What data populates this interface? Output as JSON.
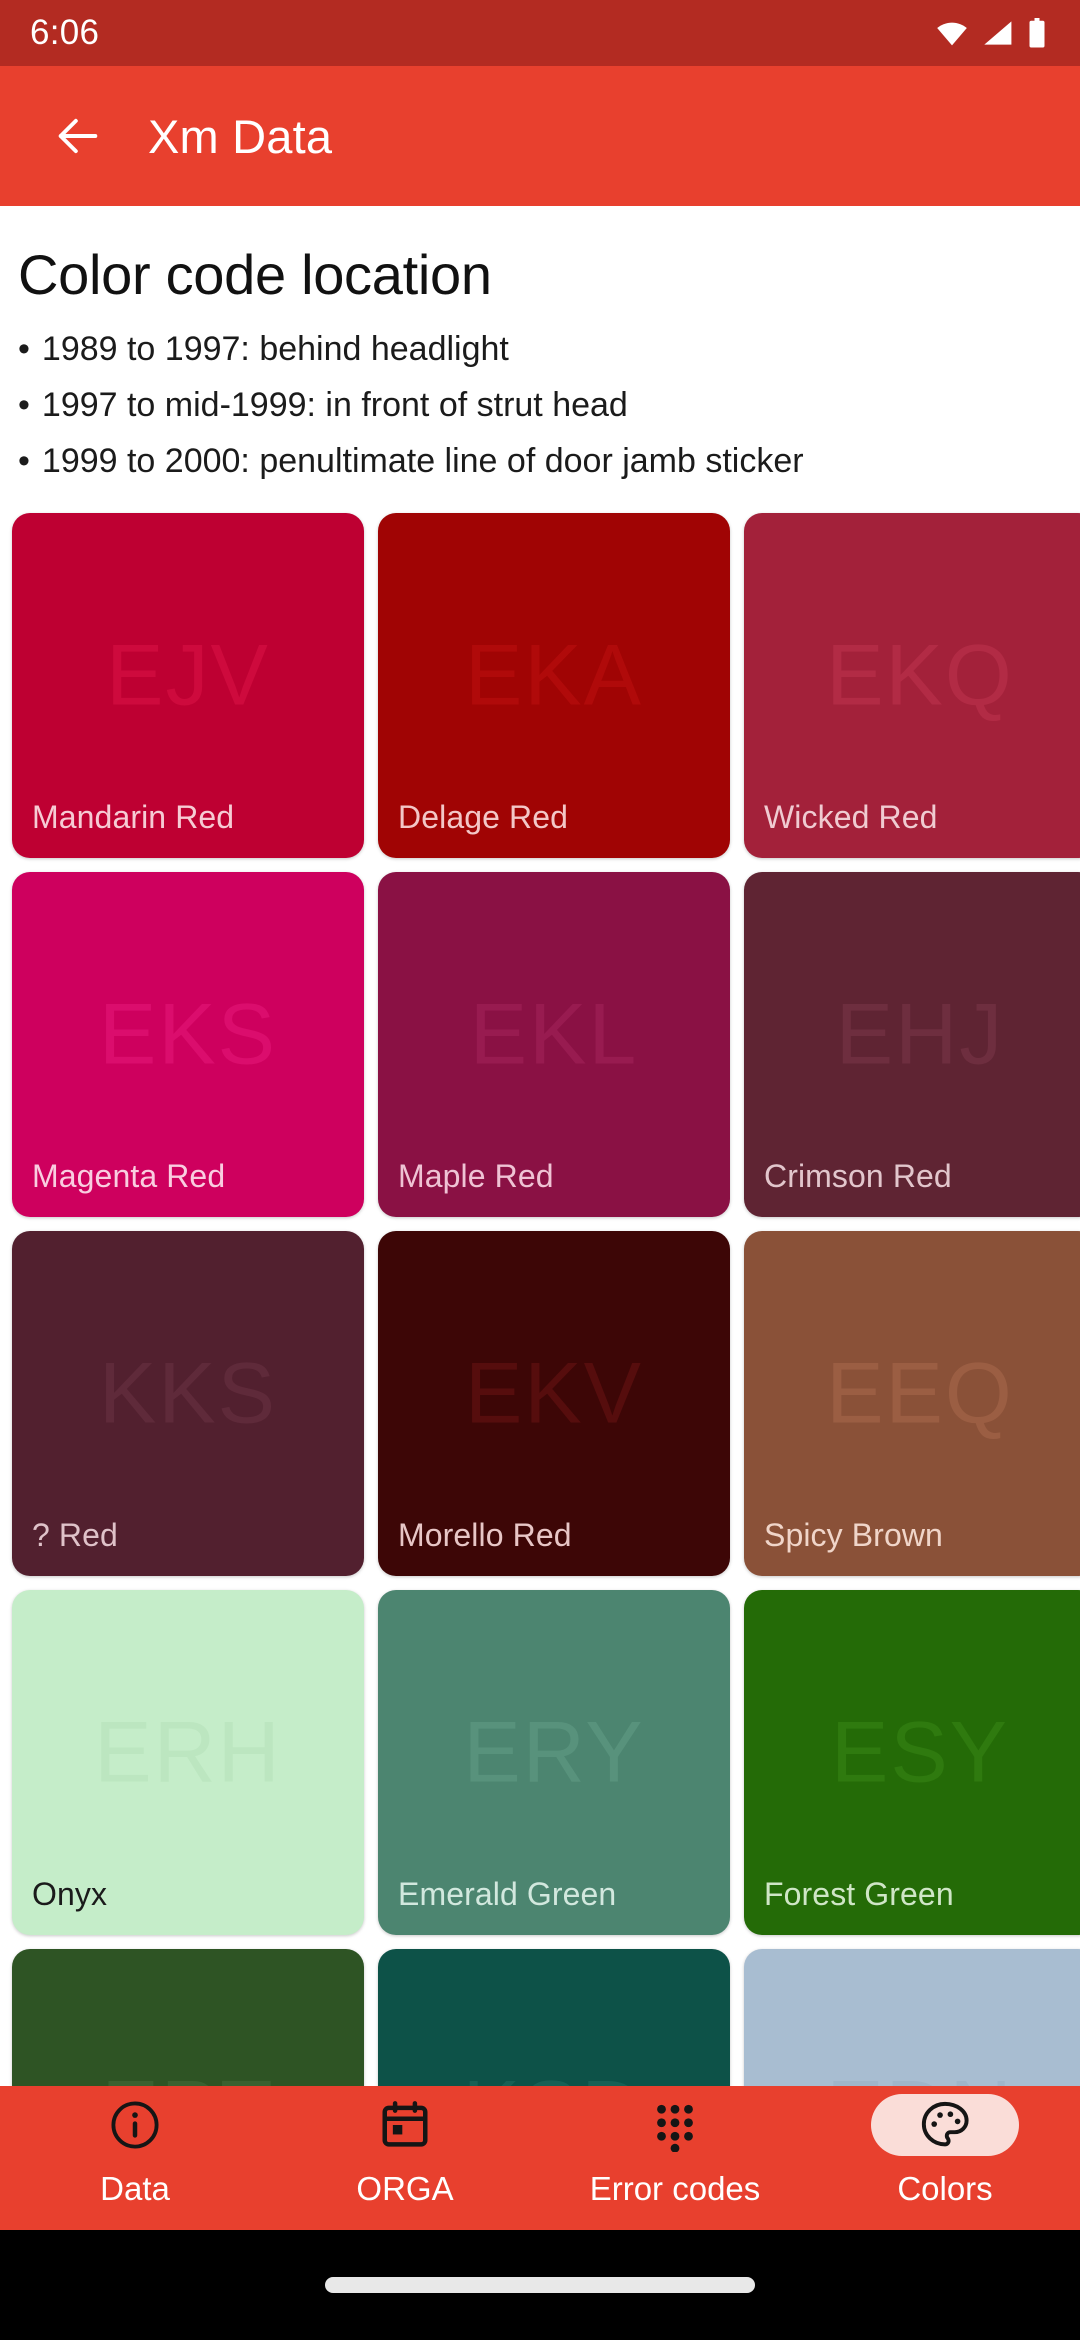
{
  "status_bar": {
    "time": "6:06",
    "icons": [
      "wifi-icon",
      "cellular-signal-icon",
      "battery-icon"
    ],
    "background": "#B32B22"
  },
  "app_bar": {
    "back_icon": "arrow-left-icon",
    "title": "Xm Data",
    "background": "#E8402E"
  },
  "main": {
    "page_title": "Color code location",
    "bullets": [
      "1989 to 1997: behind headlight",
      "1997 to mid-1999: in front of strut head",
      "1999 to 2000: penultimate line of door jamb sticker"
    ],
    "bullet_marker": "•",
    "colors": [
      {
        "code": "EJV",
        "name": "Mandarin Red",
        "hex": "#BE0032",
        "code_color": "#CE0A3D",
        "label_color": "#F6CBD4"
      },
      {
        "code": "EKA",
        "name": "Delage Red",
        "hex": "#A00404",
        "code_color": "#B00A0A",
        "label_color": "#F3C7C7"
      },
      {
        "code": "EKQ",
        "name": "Wicked Red",
        "hex": "#A3213A",
        "code_color": "#B22B45",
        "label_color": "#F0CBD1"
      },
      {
        "code": "EKS",
        "name": "Magenta Red",
        "hex": "#CE005E",
        "code_color": "#DB0D6D",
        "label_color": "#F9CDE0"
      },
      {
        "code": "EKL",
        "name": "Maple Red",
        "hex": "#8A1144",
        "code_color": "#981B50",
        "label_color": "#EFC3D4"
      },
      {
        "code": "EHJ",
        "name": "Crimson Red",
        "hex": "#5F2433",
        "code_color": "#6E2E3F",
        "label_color": "#E2C6CC"
      },
      {
        "code": "KKS",
        "name": "? Red",
        "hex": "#52202F",
        "code_color": "#5F2A3A",
        "label_color": "#DFC2C9"
      },
      {
        "code": "EKV",
        "name": "Morello Red",
        "hex": "#3D0606",
        "code_color": "#560D0D",
        "label_color": "#E8C6C6"
      },
      {
        "code": "EEQ",
        "name": "Spicy Brown",
        "hex": "#8A5138",
        "code_color": "#9B5E43",
        "label_color": "#F0D5C9"
      },
      {
        "code": "ERH",
        "name": "Onyx",
        "hex": "#C5EDC9",
        "code_color": "#BCE6C0",
        "label_color": "#1b1b1b"
      },
      {
        "code": "ERY",
        "name": "Emerald Green",
        "hex": "#4C8570",
        "code_color": "#58927C",
        "label_color": "#D2E8DE"
      },
      {
        "code": "ESY",
        "name": "Forest Green",
        "hex": "#246B07",
        "code_color": "#2F7A0F",
        "label_color": "#CFE6C6"
      },
      {
        "code": "EPT",
        "name": "",
        "hex": "#2E5424",
        "code_color": "#3A6130",
        "label_color": "#D4E4CC"
      },
      {
        "code": "KSD",
        "name": "",
        "hex": "#0D5248",
        "code_color": "#186055",
        "label_color": "#C9E1DC"
      },
      {
        "code": "EDN",
        "name": "",
        "hex": "#A8BDD1",
        "code_color": "#9FB5CA",
        "label_color": "#1b1b1b"
      }
    ]
  },
  "bottom_nav": {
    "background": "#E8402E",
    "active_pill_color": "#FADDD8",
    "items": [
      {
        "label": "Data",
        "icon": "info-circle-icon",
        "active": false
      },
      {
        "label": "ORGA",
        "icon": "calendar-icon",
        "active": false
      },
      {
        "label": "Error codes",
        "icon": "dialpad-icon",
        "active": false
      },
      {
        "label": "Colors",
        "icon": "palette-icon",
        "active": true
      }
    ]
  },
  "gesture_bar": {
    "handle": "home-indicator"
  }
}
